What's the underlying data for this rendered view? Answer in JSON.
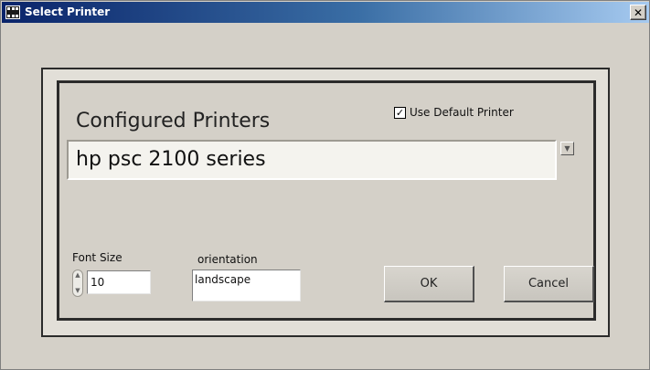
{
  "window": {
    "title": "Select Printer",
    "close_symbol": "✕"
  },
  "printers": {
    "heading": "Configured Printers",
    "selected": "hp psc 2100 series",
    "dropdown_symbol": "▼"
  },
  "use_default": {
    "label": "Use Default Printer",
    "checked_symbol": "✓"
  },
  "font_size": {
    "label": "Font Size",
    "value": "10"
  },
  "orientation": {
    "label": "orientation",
    "value": "landscape"
  },
  "buttons": {
    "ok": "OK",
    "cancel": "Cancel"
  },
  "icons": {
    "app": "labview-vi-icon",
    "close": "close-icon",
    "dropdown": "chevron-down-icon",
    "spinner": "increment-decrement-icon"
  }
}
